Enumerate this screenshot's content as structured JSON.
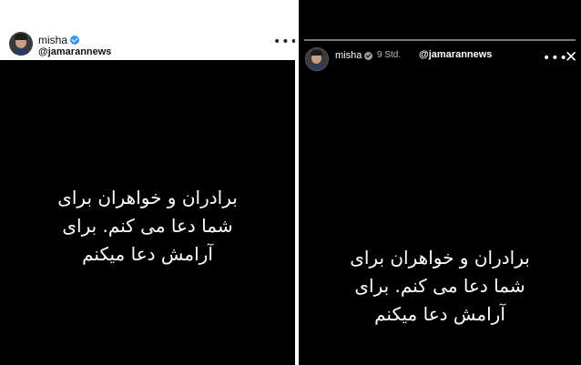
{
  "left_post": {
    "top_faint_text": "",
    "username": "misha",
    "handle": "@jamarannews",
    "more_icon": "more-icon",
    "story_lines": [
      "برادران و خواهران برای",
      "شما دعا می کنم. برای",
      "آرامش دعا میکنم"
    ]
  },
  "right_story": {
    "username": "misha",
    "time": "9 Std.",
    "handle": "@jamarannews",
    "more_icon": "more-icon",
    "close_icon": "close-icon",
    "story_lines": [
      "برادران و خواهران برای",
      "شما دعا می کنم. برای",
      "آرامش دعا میکنم"
    ]
  },
  "colors": {
    "story_background": "#000000",
    "verified_badge": "#3897f0",
    "text_on_dark": "#ffffff"
  }
}
